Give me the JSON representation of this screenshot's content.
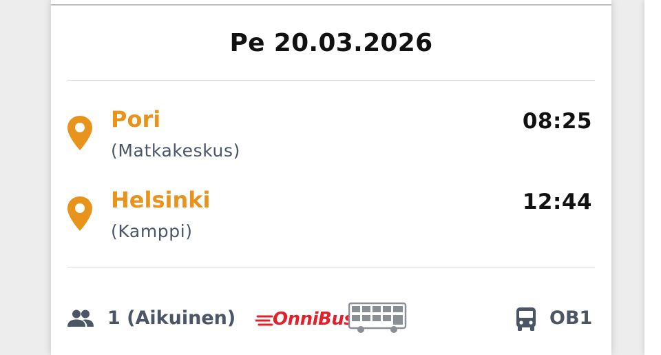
{
  "trip": {
    "date": "Pe 20.03.2026",
    "departure": {
      "city": "Pori",
      "station": "(Matkakeskus)",
      "time": "08:25"
    },
    "arrival": {
      "city": "Helsinki",
      "station": "(Kamppi)",
      "time": "12:44"
    }
  },
  "footer": {
    "passengers": "1 (Aikuinen)",
    "operator_brand": "OnniBus",
    "route_code": "OB1"
  },
  "icons": {
    "departure_pin": "map-pin-icon",
    "arrival_pin": "map-pin-icon",
    "passengers": "people-icon",
    "operator_bus": "double-decker-bus-icon",
    "route_bus": "bus-icon"
  },
  "colors": {
    "accent_orange": "#e8941c",
    "brand_red": "#e3202a",
    "muted_text": "#4b5566"
  }
}
